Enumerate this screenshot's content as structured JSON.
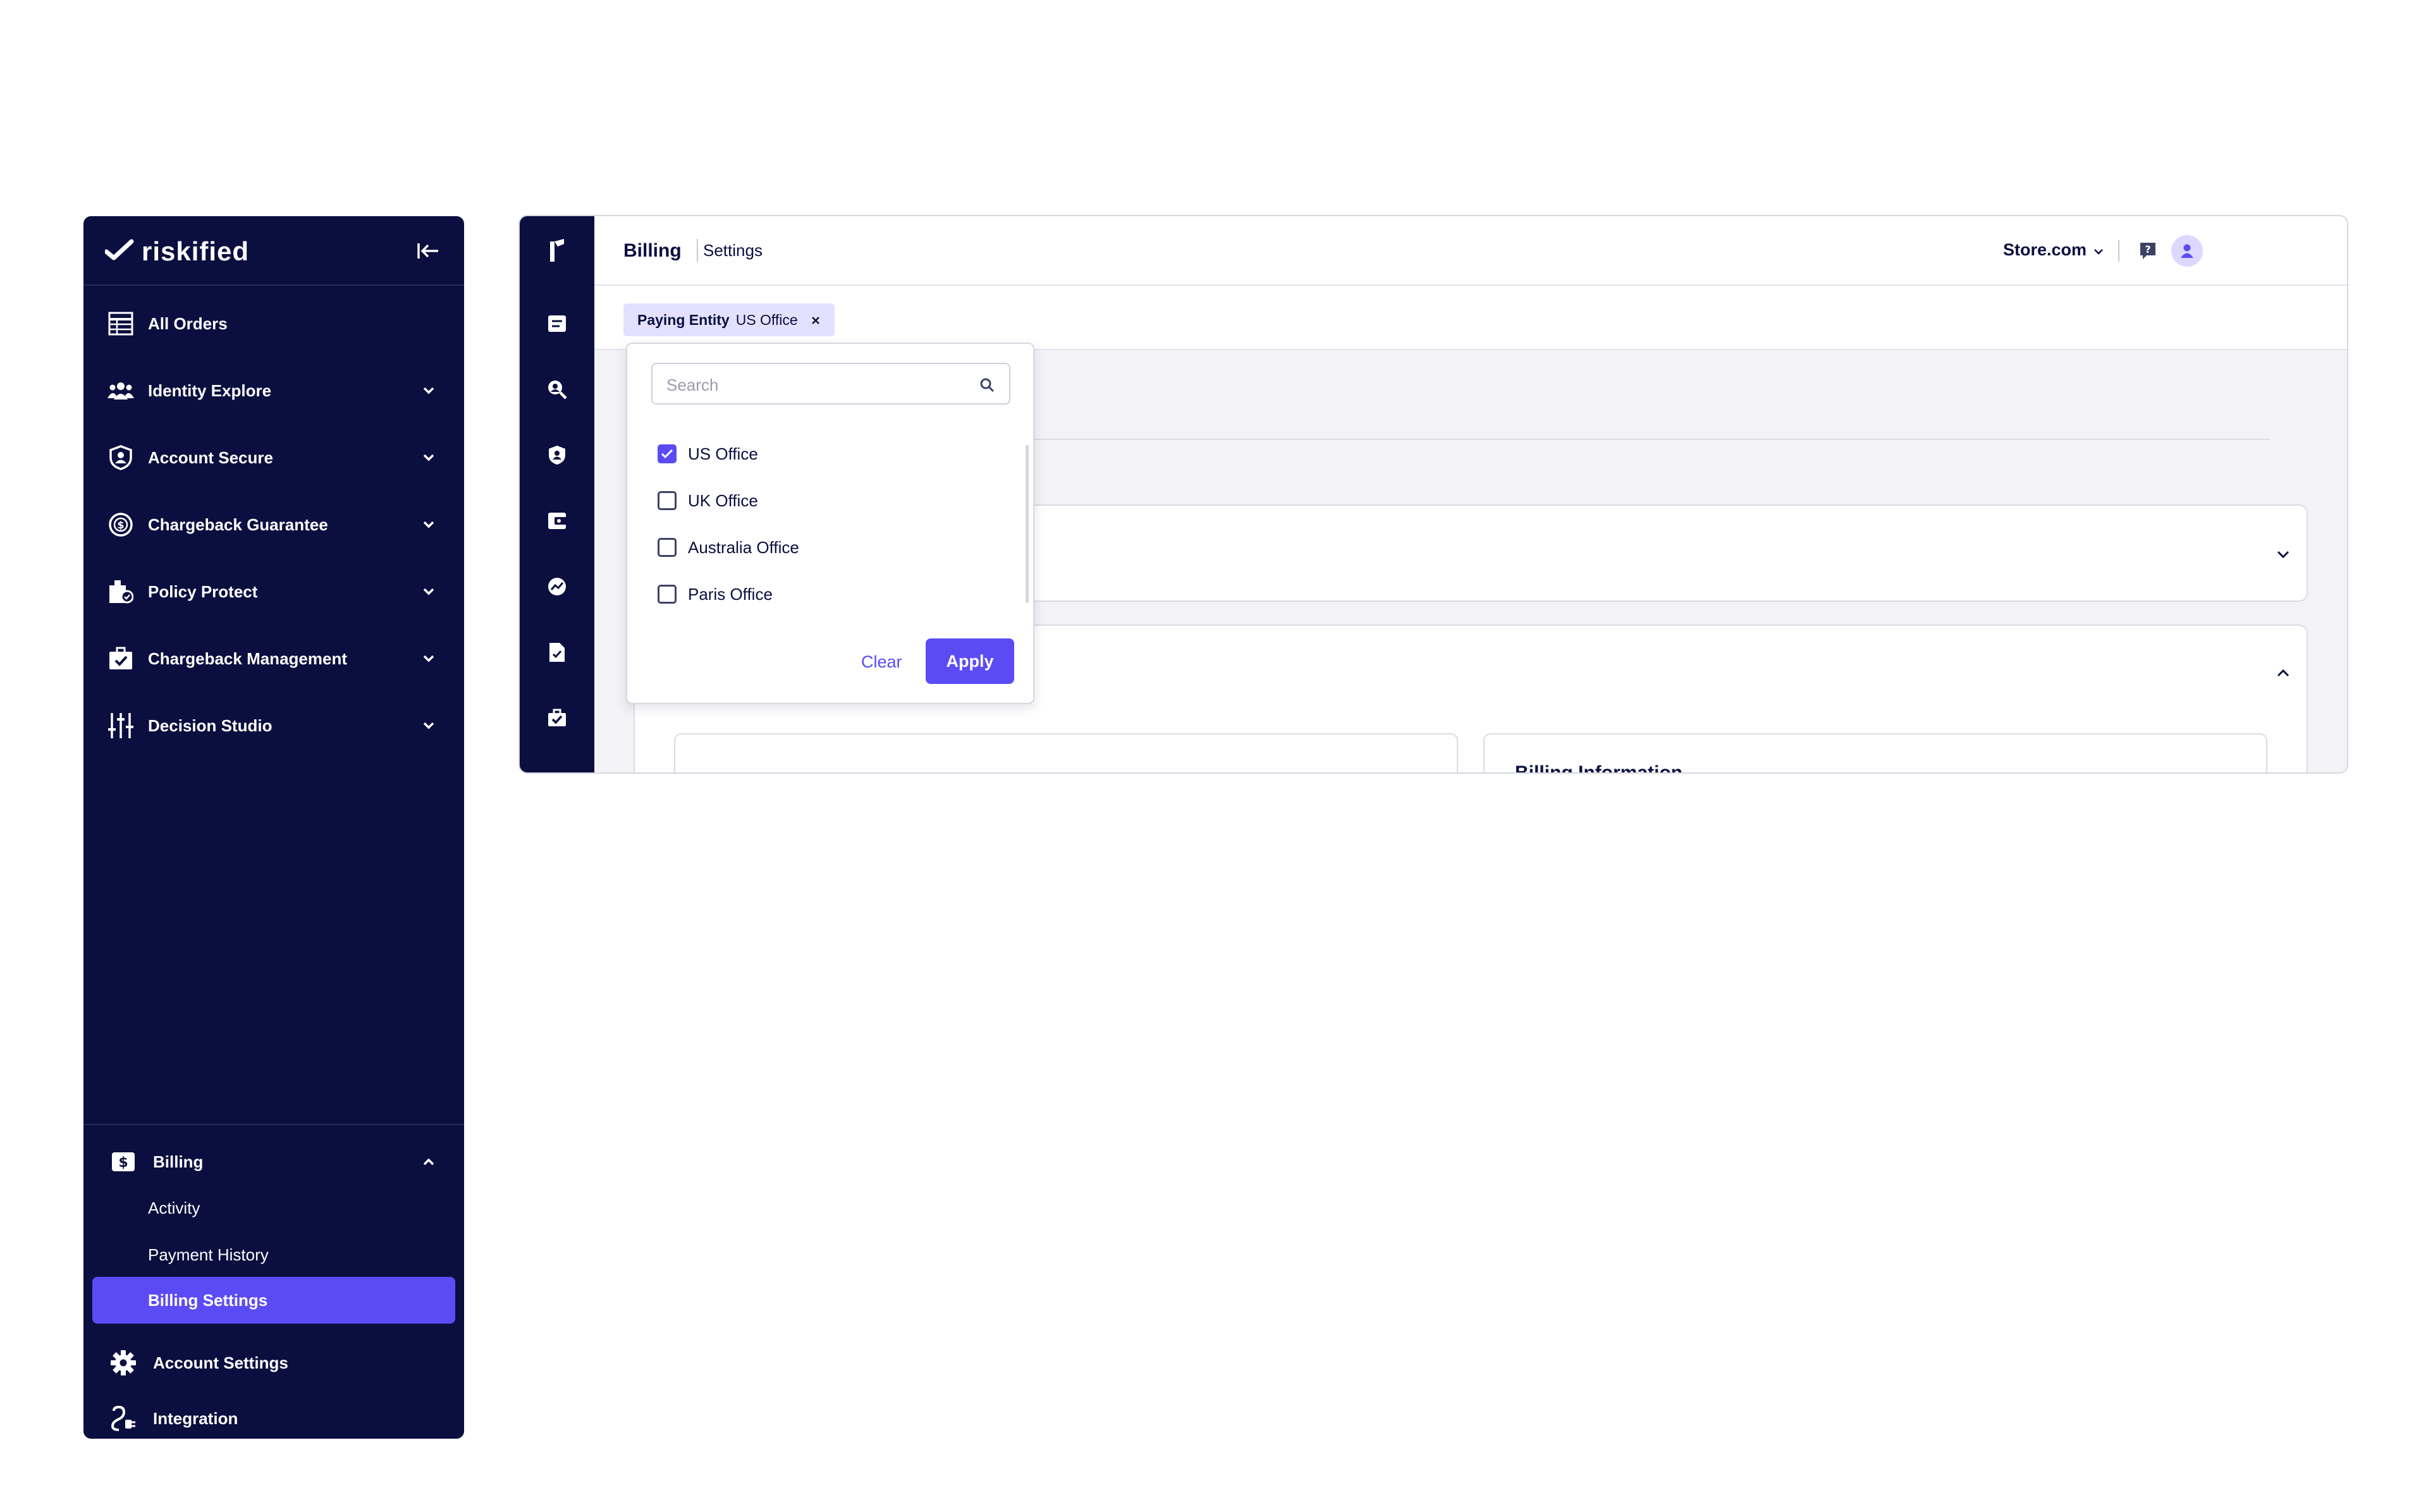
{
  "sidebar": {
    "logo_text": "riskified",
    "nav": [
      {
        "label": "All Orders",
        "icon": "table-icon",
        "expandable": false
      },
      {
        "label": "Identity Explore",
        "icon": "users-icon",
        "expandable": true
      },
      {
        "label": "Account Secure",
        "icon": "shield-user-icon",
        "expandable": true
      },
      {
        "label": "Chargeback Guarantee",
        "icon": "dollar-circle-icon",
        "expandable": true
      },
      {
        "label": "Policy Protect",
        "icon": "policy-icon",
        "expandable": true
      },
      {
        "label": "Chargeback Management",
        "icon": "briefcase-check-icon",
        "expandable": true
      },
      {
        "label": "Decision Studio",
        "icon": "sliders-icon",
        "expandable": true
      }
    ],
    "billing": {
      "label": "Billing",
      "sub_items": [
        "Activity",
        "Payment History",
        "Billing Settings"
      ],
      "active": "Billing Settings"
    },
    "account_settings": "Account Settings",
    "integration": "Integration"
  },
  "topbar": {
    "breadcrumb_section": "Billing",
    "breadcrumb_page": "Settings",
    "store": "Store.com"
  },
  "filter_chip": {
    "key": "Paying Entity",
    "value": "US Office"
  },
  "dropdown": {
    "search_placeholder": "Search",
    "options": [
      {
        "label": "US Office",
        "checked": true
      },
      {
        "label": "UK Office",
        "checked": false
      },
      {
        "label": "Australia Office",
        "checked": false
      },
      {
        "label": "Paris Office",
        "checked": false
      }
    ],
    "clear_label": "Clear",
    "apply_label": "Apply"
  },
  "content": {
    "card_title_partial": "Billing Information"
  },
  "colors": {
    "nav_bg": "#0a0f3f",
    "accent": "#5b4bf5",
    "chip_bg": "#e4e1ff"
  }
}
